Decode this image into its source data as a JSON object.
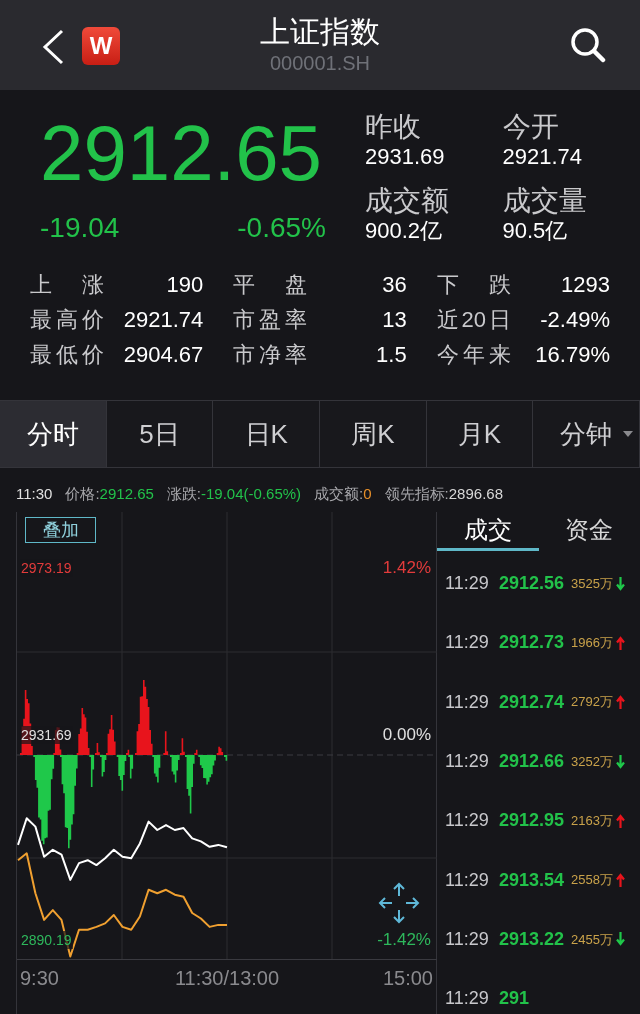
{
  "header": {
    "logo": "W",
    "title": "上证指数",
    "code": "000001.SH"
  },
  "quote": {
    "price": "2912.65",
    "change": "-19.04",
    "change_pct": "-0.65%",
    "rising": false
  },
  "summary": [
    {
      "label": "昨收",
      "value": "2931.69"
    },
    {
      "label": "今开",
      "value": "2921.74"
    },
    {
      "label": "成交额",
      "value": "900.2亿"
    },
    {
      "label": "成交量",
      "value": "90.5亿"
    }
  ],
  "stats": [
    {
      "label": "上涨",
      "value": "190"
    },
    {
      "label": "平盘",
      "value": "36"
    },
    {
      "label": "下跌",
      "value": "1293"
    },
    {
      "label": "最高价",
      "value": "2921.74"
    },
    {
      "label": "市盈率",
      "value": "13"
    },
    {
      "label": "近20日",
      "value": "-2.49%"
    },
    {
      "label": "最低价",
      "value": "2904.67"
    },
    {
      "label": "市净率",
      "value": "1.5"
    },
    {
      "label": "今年来",
      "value": "16.79%"
    }
  ],
  "tabs": [
    {
      "label": "分时",
      "selected": true,
      "dropdown": false
    },
    {
      "label": "5日",
      "selected": false,
      "dropdown": false
    },
    {
      "label": "日K",
      "selected": false,
      "dropdown": false
    },
    {
      "label": "周K",
      "selected": false,
      "dropdown": false
    },
    {
      "label": "月K",
      "selected": false,
      "dropdown": false
    },
    {
      "label": "分钟",
      "selected": false,
      "dropdown": true
    }
  ],
  "info_line": {
    "time": "11:30",
    "fields": [
      {
        "label": "价格:",
        "value": "2912.65",
        "color": "#22c24a"
      },
      {
        "label": "涨跌:",
        "value": "-19.04(-0.65%)",
        "color": "#22c24a"
      },
      {
        "label": "成交额:",
        "value": "0",
        "color": "#e8902a"
      },
      {
        "label": "领先指标:",
        "value": "2896.68",
        "color": "#d8d8d8"
      }
    ]
  },
  "chart": {
    "overlay_button": "叠加",
    "price_labels": [
      "2973.19",
      "2931.69",
      "2890.19"
    ],
    "percent_labels": [
      "1.42%",
      "0.00%",
      "-1.42%"
    ],
    "time_labels": [
      "9:30",
      "11:30/13:00",
      "15:00"
    ]
  },
  "trades": {
    "tabs": [
      {
        "label": "成交",
        "selected": true
      },
      {
        "label": "资金",
        "selected": false
      }
    ],
    "rows": [
      {
        "time": "11:29",
        "price": "2912.56",
        "volume": "3525万",
        "rising": false
      },
      {
        "time": "11:29",
        "price": "2912.73",
        "volume": "1966万",
        "rising": true
      },
      {
        "time": "11:29",
        "price": "2912.74",
        "volume": "2792万",
        "rising": true
      },
      {
        "time": "11:29",
        "price": "2912.66",
        "volume": "3252万",
        "rising": false
      },
      {
        "time": "11:29",
        "price": "2912.95",
        "volume": "2163万",
        "rising": true
      },
      {
        "time": "11:29",
        "price": "2913.54",
        "volume": "2558万",
        "rising": true
      },
      {
        "time": "11:29",
        "price": "2913.22",
        "volume": "2455万",
        "rising": false
      },
      {
        "time": "11:29",
        "price": "291"
      }
    ]
  }
}
